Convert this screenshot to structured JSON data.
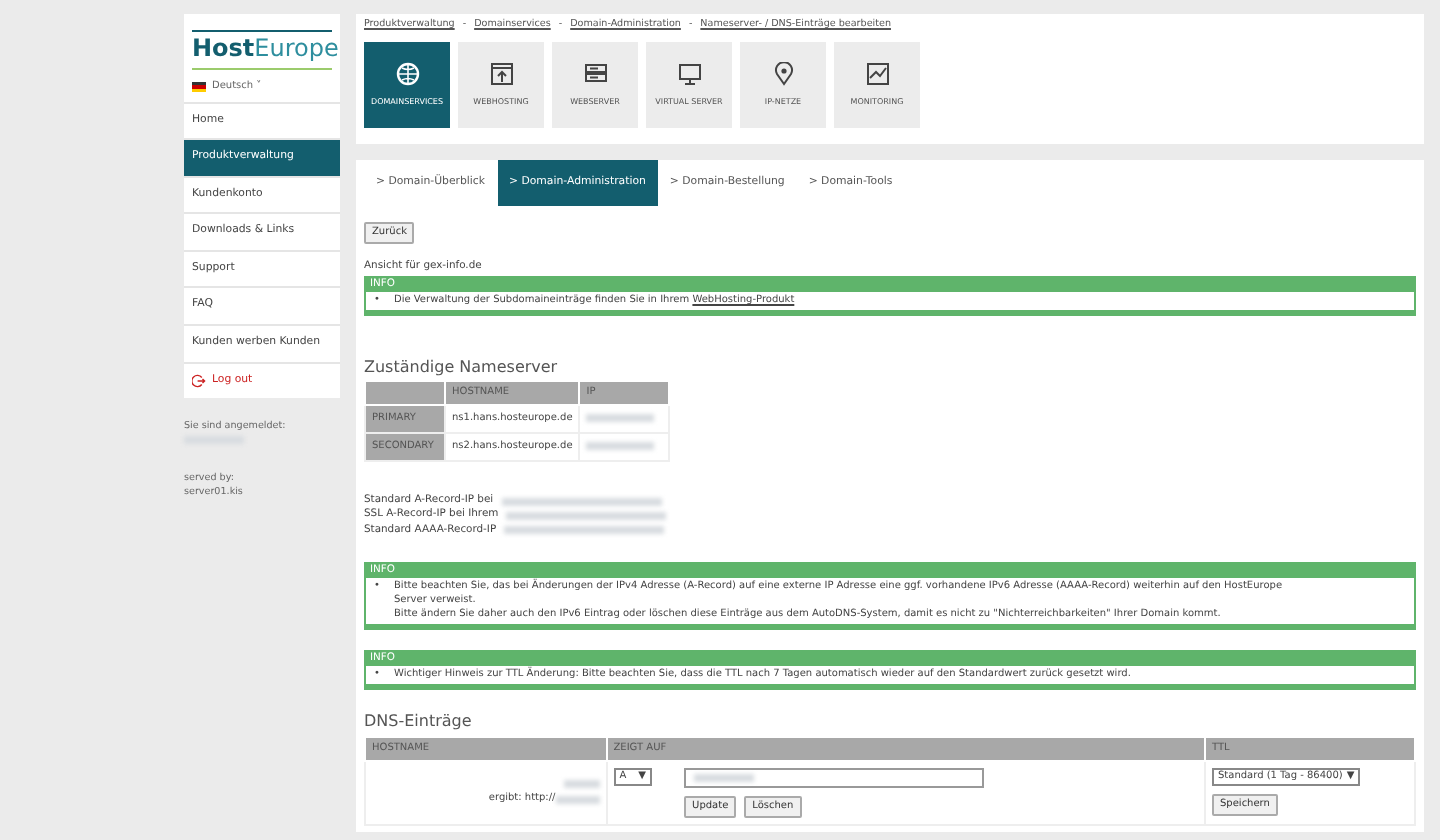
{
  "logo": {
    "part_1": "Host",
    "part_2": "Europe"
  },
  "language": {
    "label": "Deutsch",
    "caret": "˅"
  },
  "sidebar": {
    "items": [
      {
        "label": "Home",
        "kind": "link",
        "selected": false
      },
      {
        "label": "Produktverwaltung",
        "kind": "link",
        "selected": true
      },
      {
        "label": "Kundenkonto",
        "kind": "link",
        "selected": false
      },
      {
        "label": "Downloads & Links",
        "kind": "link",
        "selected": false
      },
      {
        "label": "Support",
        "kind": "link",
        "selected": false
      },
      {
        "label": "FAQ",
        "kind": "link",
        "selected": false
      },
      {
        "label": "Kunden werben Kunden",
        "kind": "link",
        "selected": false
      },
      {
        "label": "Log out",
        "kind": "logout",
        "selected": false
      }
    ],
    "login_label": "Sie sind angemeldet:",
    "served_label": "served by:",
    "server": "server01.kis"
  },
  "breadcrumb": {
    "separator": "-",
    "items": [
      "Produktverwaltung",
      "Domainservices",
      "Domain-Administration",
      "Nameserver- / DNS-Einträge bearbeiten"
    ]
  },
  "services": [
    {
      "label": "DOMAINSERVICES",
      "selected": true
    },
    {
      "label": "WEBHOSTING",
      "selected": false
    },
    {
      "label": "WEBSERVER",
      "selected": false
    },
    {
      "label": "VIRTUAL SERVER",
      "selected": false
    },
    {
      "label": "IP-NETZE",
      "selected": false
    },
    {
      "label": "MONITORING",
      "selected": false
    }
  ],
  "tabs": [
    {
      "label": "> Domain-Überblick",
      "selected": false
    },
    {
      "label": "> Domain-Administration",
      "selected": true
    },
    {
      "label": "> Domain-Bestellung",
      "selected": false
    },
    {
      "label": "> Domain-Tools",
      "selected": false
    }
  ],
  "back_button": "Zurück",
  "view_for": "Ansicht für gex-info.de",
  "info_boxes": [
    {
      "title": "INFO",
      "bullet": "•",
      "lines": [
        "Die Verwaltung der Subdomaineinträge finden Sie in Ihrem "
      ],
      "link": "WebHosting-Produkt"
    },
    {
      "title": "INFO",
      "bullet": "•",
      "lines": [
        "Bitte beachten Sie, das bei Änderungen der IPv4 Adresse (A-Record) auf eine externe IP Adresse eine ggf. vorhandene IPv6 Adresse (AAAA-Record) weiterhin auf den HostEurope Server verweist.",
        "Bitte ändern Sie daher auch den IPv6 Eintrag oder löschen diese Einträge aus dem AutoDNS-System, damit es nicht zu \"Nichterreichbarkeiten\" Ihrer Domain kommt."
      ]
    },
    {
      "title": "INFO",
      "bullet": "•",
      "lines": [
        "Wichtiger Hinweis zur TTL Änderung: Bitte beachten Sie, dass die TTL nach 7 Tagen automatisch wieder auf den Standardwert zurück gesetzt wird."
      ]
    }
  ],
  "nameserver": {
    "title": "Zuständige Nameserver",
    "columns": [
      "HOSTNAME",
      "IP"
    ],
    "rows": [
      {
        "label": "PRIMARY",
        "hostname": "ns1.hans.hosteurope.de"
      },
      {
        "label": "SECONDARY",
        "hostname": "ns2.hans.hosteurope.de"
      }
    ]
  },
  "records": [
    "Standard A-Record-IP bei",
    "SSL A-Record-IP bei Ihrem",
    "Standard AAAA-Record-IP"
  ],
  "dns": {
    "title": "DNS-Einträge",
    "columns": [
      "HOSTNAME",
      "ZEIGT AUF",
      "TTL"
    ],
    "rows": [
      {
        "hostname": "ergibt: http://",
        "type": "A",
        "type_caret": "▼",
        "ttl_caret": "▼",
        "ttl": "Standard (1 Tag - 86400)",
        "buttons": [
          "Update",
          "Löschen"
        ],
        "save": "Speichern"
      }
    ]
  }
}
